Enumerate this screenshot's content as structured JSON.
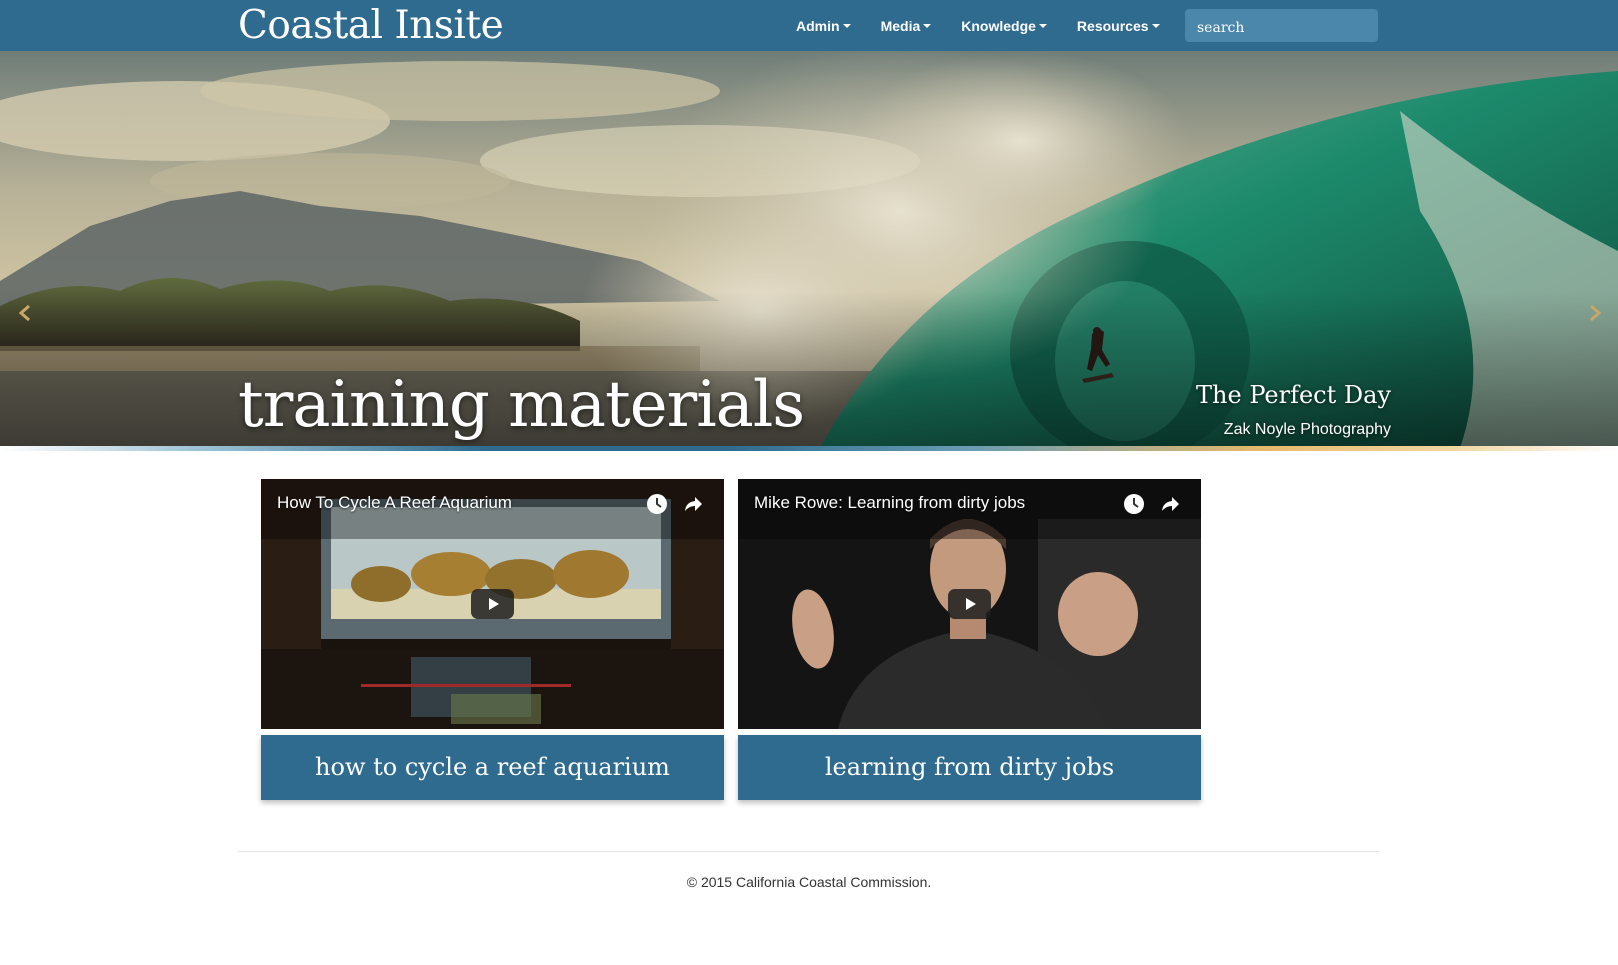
{
  "navbar": {
    "brand": "Coastal Insite",
    "menu": [
      {
        "label": "Admin"
      },
      {
        "label": "Media"
      },
      {
        "label": "Knowledge"
      },
      {
        "label": "Resources"
      }
    ],
    "search_placeholder": "search"
  },
  "hero": {
    "title": "training materials",
    "caption_title": "The Perfect Day",
    "caption_credit": "Zak Noyle Photography",
    "prev_icon": "chevron-left-icon",
    "next_icon": "chevron-right-icon"
  },
  "videos": [
    {
      "player_title": "How To Cycle A Reef Aquarium",
      "label": "how to cycle a reef aquarium"
    },
    {
      "player_title": "Mike Rowe: Learning from dirty jobs",
      "label": "learning from dirty jobs"
    }
  ],
  "footer": {
    "copyright": "© 2015 California Coastal Commission."
  },
  "colors": {
    "brand_blue": "#2e6b8f",
    "search_bg": "#4a87aa"
  }
}
